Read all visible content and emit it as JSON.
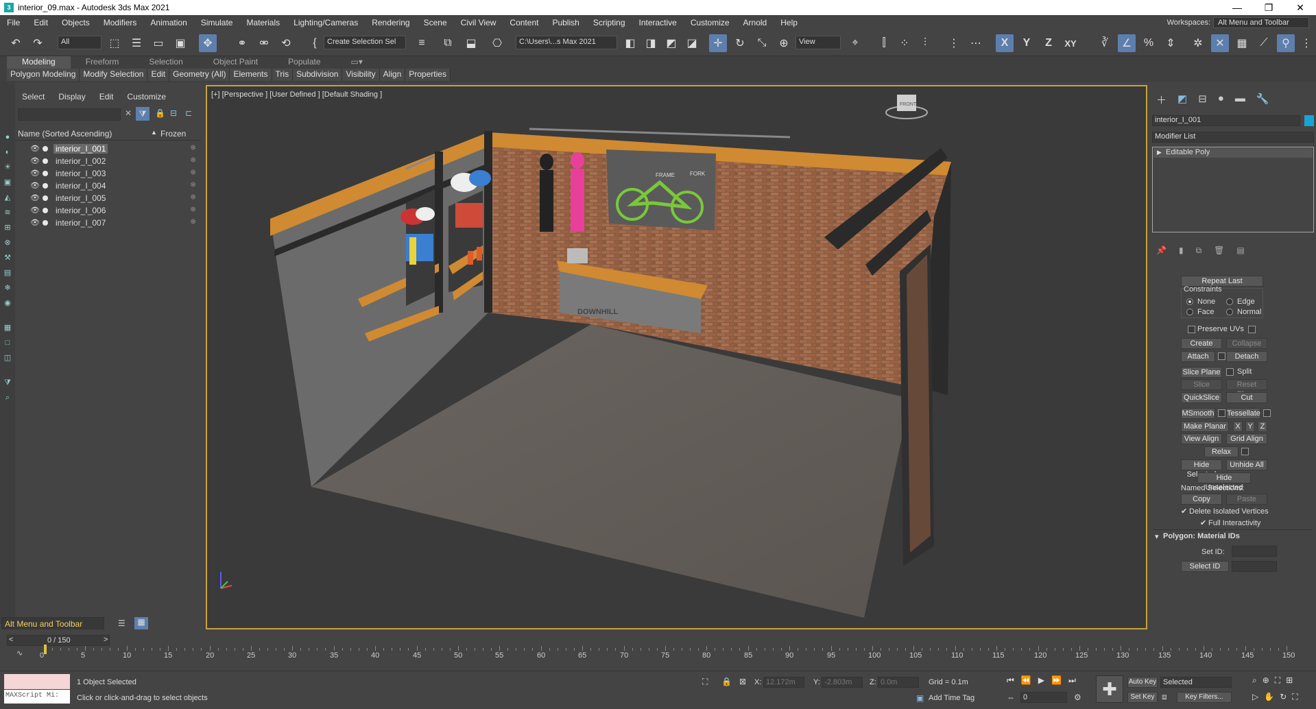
{
  "titlebar": {
    "icon_text": "3",
    "title": "interior_09.max - Autodesk 3ds Max 2021",
    "minimize": "—",
    "maximize": "❐",
    "close": "✕"
  },
  "menubar": {
    "items": [
      "File",
      "Edit",
      "Objects",
      "Modifiers",
      "Animation",
      "Simulate",
      "Materials",
      "Lighting/Cameras",
      "Rendering",
      "Scene",
      "Civil View",
      "Content",
      "Publish",
      "Scripting",
      "Interactive",
      "Customize",
      "Arnold",
      "Help"
    ],
    "workspaces_label": "Workspaces:",
    "workspaces_value": "Alt Menu and Toolbar"
  },
  "toolbar": {
    "filter_value": "All",
    "selection_set_value": "Create Selection Sel",
    "project_path": "C:\\Users\\...s Max 2021",
    "view_value": "View",
    "axis_x": "X",
    "axis_y": "Y",
    "axis_z": "Z",
    "axis_xy": "XY"
  },
  "ribbon": {
    "tabs": [
      "Modeling",
      "Freeform",
      "Selection",
      "Object Paint",
      "Populate"
    ],
    "subtabs": [
      "Polygon Modeling",
      "Modify Selection",
      "Edit",
      "Geometry (All)",
      "Elements",
      "Tris",
      "Subdivision",
      "Visibility",
      "Align",
      "Properties"
    ]
  },
  "scene_explorer": {
    "menu": [
      "Select",
      "Display",
      "Edit",
      "Customize"
    ],
    "col_name": "Name (Sorted Ascending)",
    "col_frozen": "Frozen",
    "sort_arrow": "▲",
    "objects": [
      "interior_I_001",
      "interior_I_002",
      "interior_I_003",
      "interior_I_004",
      "interior_I_005",
      "interior_I_006",
      "interior_I_007"
    ],
    "bottom_workspace": "Alt Menu and Toolbar"
  },
  "viewport": {
    "label": "[+] [Perspective ] [User Defined ] [Default Shading ]",
    "scene_text": {
      "wall_sign": "FRAME",
      "wall_sign2": "FORK",
      "counter_logo": "DOWNHILL",
      "viewcube": "FRONT"
    }
  },
  "command_panel": {
    "object_name": "interior_I_001",
    "object_color": "#1aa3d6",
    "modifier_list": "Modifier List",
    "stack_item": "Editable Poly",
    "repeat_last": "Repeat Last",
    "constraints": "Constraints",
    "c_none": "None",
    "c_edge": "Edge",
    "c_face": "Face",
    "c_normal": "Normal",
    "preserve_uvs": "Preserve UVs",
    "create": "Create",
    "collapse": "Collapse",
    "attach": "Attach",
    "detach": "Detach",
    "slice_plane": "Slice Plane",
    "split": "Split",
    "slice": "Slice",
    "reset_plane": "Reset Plane",
    "quickslice": "QuickSlice",
    "cut": "Cut",
    "msmooth": "MSmooth",
    "tessellate": "Tessellate",
    "make_planar": "Make Planar",
    "px": "X",
    "py": "Y",
    "pz": "Z",
    "view_align": "View Align",
    "grid_align": "Grid Align",
    "relax": "Relax",
    "hide_selected": "Hide Selected",
    "unhide_all": "Unhide All",
    "hide_unselected": "Hide Unselected",
    "named_selections": "Named Selections:",
    "copy": "Copy",
    "paste": "Paste",
    "delete_isolated": "Delete Isolated Vertices",
    "full_interactivity": "Full Interactivity",
    "rollout_material_ids": "Polygon: Material IDs",
    "set_id": "Set ID:",
    "select_id": "Select ID"
  },
  "timeline": {
    "frame_display": "0 / 150",
    "ticks": [
      "0",
      "5",
      "10",
      "15",
      "20",
      "25",
      "30",
      "35",
      "40",
      "45",
      "50",
      "55",
      "60",
      "65",
      "70",
      "75",
      "80",
      "85",
      "90",
      "95",
      "100",
      "105",
      "110",
      "115",
      "120",
      "125",
      "130",
      "135",
      "140",
      "145",
      "150"
    ]
  },
  "status": {
    "maxscript": "MAXScript Mi:",
    "selected": "1 Object Selected",
    "prompt": "Click or click-and-drag to select objects",
    "x_label": "X:",
    "x_value": "12.172m",
    "y_label": "Y:",
    "y_value": "-2.803m",
    "z_label": "Z:",
    "z_value": "0.0m",
    "grid": "Grid = 0.1m",
    "add_time_tag": "Add Time Tag",
    "auto_key": "Auto Key",
    "selected_dd": "Selected",
    "set_key": "Set Key",
    "key_filters": "Key Filters...",
    "frame_value": "0"
  }
}
